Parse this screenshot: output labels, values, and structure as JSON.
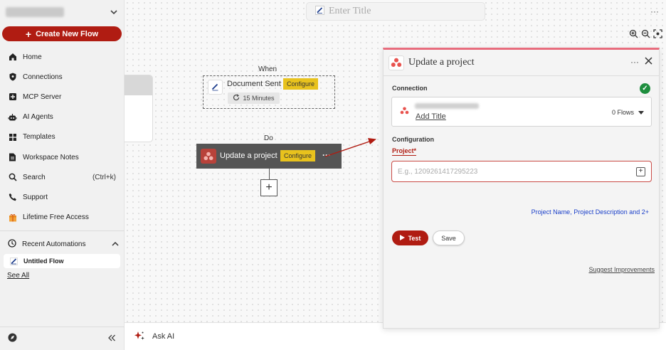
{
  "sidebar": {
    "create_label": "Create New Flow",
    "items": [
      {
        "label": "Home",
        "icon": "home-icon"
      },
      {
        "label": "Connections",
        "icon": "shield-icon"
      },
      {
        "label": "MCP Server",
        "icon": "server-icon"
      },
      {
        "label": "AI Agents",
        "icon": "robot-icon"
      },
      {
        "label": "Templates",
        "icon": "grid-icon"
      },
      {
        "label": "Workspace Notes",
        "icon": "note-icon"
      },
      {
        "label": "Search",
        "icon": "search-icon",
        "shortcut": "(Ctrl+k)"
      },
      {
        "label": "Support",
        "icon": "phone-icon"
      },
      {
        "label": "Lifetime Free Access",
        "icon": "gift-icon"
      }
    ],
    "recent": {
      "label": "Recent Automations",
      "items": [
        {
          "label": "Untitled Flow"
        }
      ]
    },
    "see_all": "See All"
  },
  "header": {
    "title_placeholder": "Enter Title",
    "more": "···"
  },
  "flow": {
    "when_label": "When",
    "trigger": {
      "title": "Document Sent",
      "configure": "Configure",
      "interval": "15 Minutes"
    },
    "do_label": "Do",
    "action": {
      "title": "Update a project",
      "configure": "Configure",
      "more": "···"
    },
    "add_step": "+"
  },
  "ask_ai": {
    "label": "Ask AI"
  },
  "panel": {
    "title": "Update a project",
    "more": "···",
    "connection_label": "Connection",
    "connection": {
      "add_title": "Add Title",
      "flows": "0 Flows"
    },
    "configuration_label": "Configuration",
    "project_label": "Project*",
    "project_placeholder": "E.g., 1209261417295223",
    "fields_link": "Project Name, Project Description and 2+",
    "test_label": "Test",
    "save_label": "Save",
    "suggest_label": "Suggest Improvements"
  },
  "colors": {
    "brand_red": "#b01c12",
    "accent_pink": "#e86c7d",
    "configure_yellow": "#e8c21d",
    "success_green": "#1e8e3e",
    "link_blue": "#1a3fc9"
  }
}
